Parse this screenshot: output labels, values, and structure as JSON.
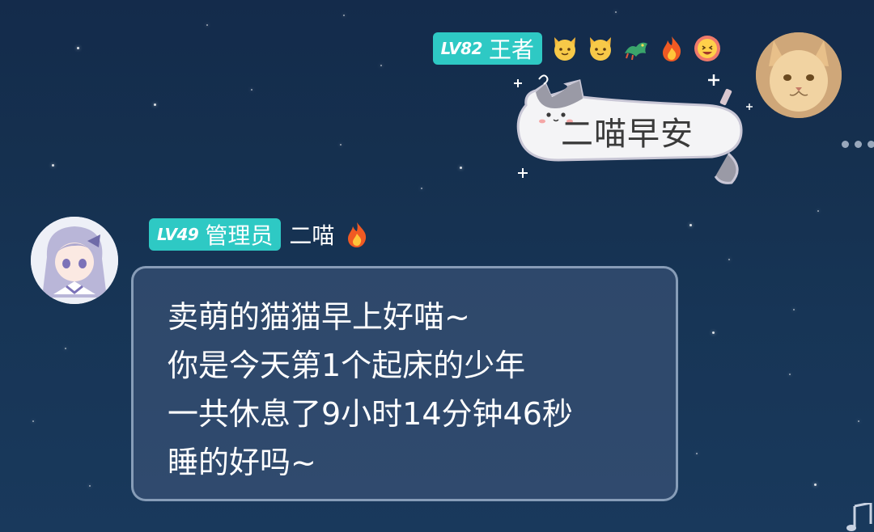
{
  "messages": [
    {
      "side": "right",
      "level_badge": "LV82",
      "role": "王者",
      "emojis": [
        "cat-face",
        "cat-face",
        "dragon",
        "fire",
        "grinning-face"
      ],
      "sticker_text": "二喵早安"
    },
    {
      "side": "left",
      "level_badge": "LV49",
      "role": "管理员",
      "name": "二喵",
      "name_emoji": "fire",
      "lines": [
        "卖萌的猫猫早上好喵~",
        "你是今天第1个起床的少年",
        "一共休息了9小时14分钟46秒",
        "睡的好吗~"
      ]
    }
  ],
  "colors": {
    "badge": "#2ec9c4",
    "background": "#15304f",
    "bubble_border": "#a5b9d2"
  }
}
